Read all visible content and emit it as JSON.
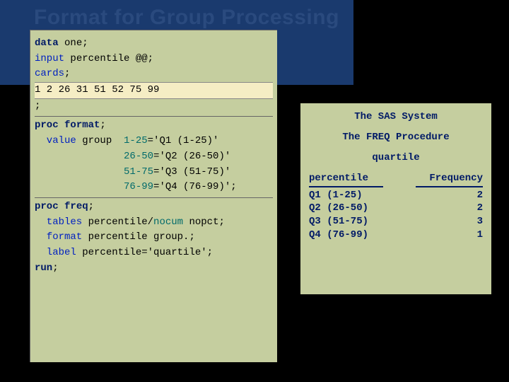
{
  "title": "Format for Group Processing",
  "code": {
    "l1_kw": "data",
    "l1_rest": " one;",
    "l2_kw": "input",
    "l2_rest": " percentile @@;",
    "l3_kw": "cards",
    "l3_rest": ";",
    "l4_data": "1 2 26 31 51 52 75 99",
    "l5": ";",
    "l6_kw": "proc",
    "l6_b": " format",
    "l6_rest": ";",
    "l7_a": "  value",
    "l7_b": " group  ",
    "l7_c": "1-25",
    "l7_d": "='Q1 (1-25)'",
    "l8_c": "26-50",
    "l8_d": "='Q2 (26-50)'",
    "l9_c": "51-75",
    "l9_d": "='Q3 (51-75)'",
    "l10_c": "76-99",
    "l10_d": "='Q4 (76-99)';",
    "l11_kw": "proc",
    "l11_b": " freq",
    "l11_rest": ";",
    "l12_a": "  tables",
    "l12_b": " percentile/",
    "l12_c": "nocum",
    "l12_d": " nopct;",
    "l13_a": "  format",
    "l13_b": " percentile group.;",
    "l14_a": "  label",
    "l14_b": " percentile=",
    "l14_c": "'quartile'",
    "l14_d": ";",
    "l15_kw": "run",
    "l15_rest": ";",
    "pad": "               "
  },
  "output": {
    "sys": "The SAS System",
    "proc": "The FREQ Procedure",
    "var": "quartile",
    "h1": "percentile",
    "h2": "Frequency",
    "rows": [
      {
        "label": "Q1 (1-25)",
        "freq": "2"
      },
      {
        "label": "Q2 (26-50)",
        "freq": "2"
      },
      {
        "label": "Q3 (51-75)",
        "freq": "3"
      },
      {
        "label": "Q4 (76-99)",
        "freq": "1"
      }
    ]
  }
}
